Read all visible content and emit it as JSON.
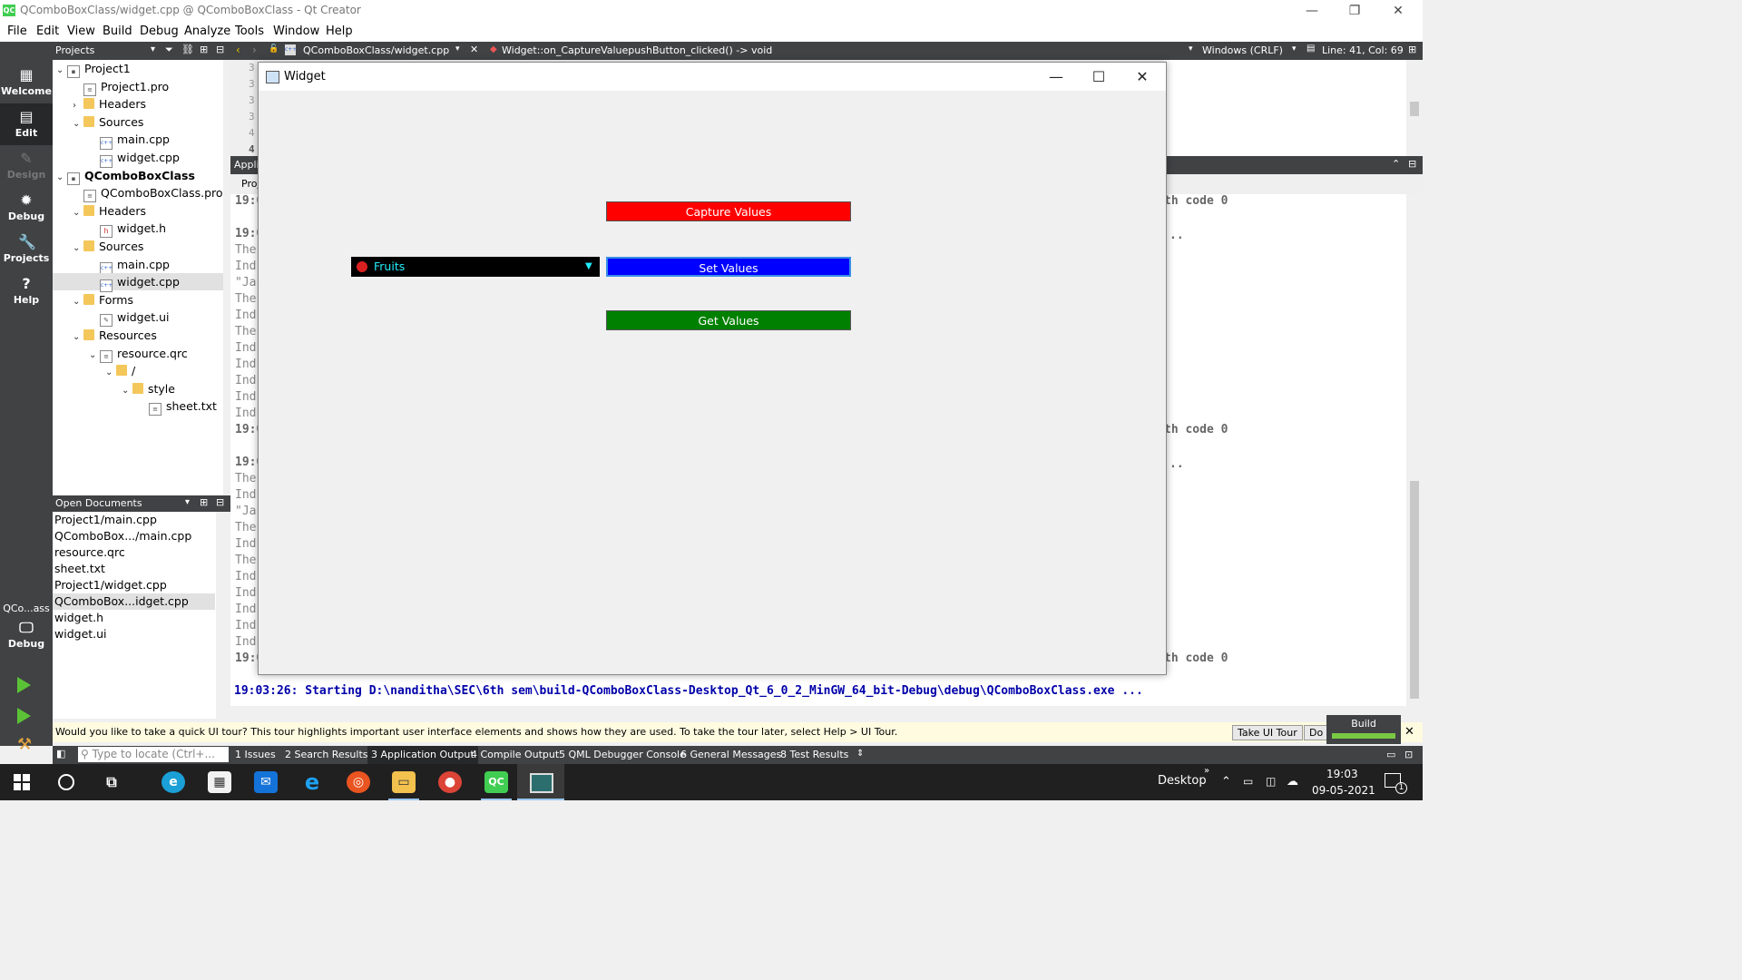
{
  "window": {
    "title": "QComboBoxClass/widget.cpp @ QComboBoxClass - Qt Creator",
    "app_logo": "QC"
  },
  "menu": [
    "File",
    "Edit",
    "View",
    "Build",
    "Debug",
    "Analyze",
    "Tools",
    "Window",
    "Help"
  ],
  "modes": [
    {
      "label": "Welcome",
      "icon": "grid-icon"
    },
    {
      "label": "Edit",
      "icon": "edit-icon"
    },
    {
      "label": "Design",
      "icon": "pencil-icon"
    },
    {
      "label": "Debug",
      "icon": "bug-icon"
    },
    {
      "label": "Projects",
      "icon": "wrench-icon"
    },
    {
      "label": "Help",
      "icon": "help-icon"
    }
  ],
  "kit": {
    "label": "QCo...ass",
    "mode": "Debug"
  },
  "projects_panel": {
    "title": "Projects",
    "tree": [
      {
        "label": "Project1",
        "depth": 0,
        "arrow": "down",
        "icon": "project",
        "bold": false
      },
      {
        "label": "Project1.pro",
        "depth": 1,
        "arrow": "",
        "icon": "pro"
      },
      {
        "label": "Headers",
        "depth": 1,
        "arrow": "right",
        "icon": "folder"
      },
      {
        "label": "Sources",
        "depth": 1,
        "arrow": "down",
        "icon": "folder"
      },
      {
        "label": "main.cpp",
        "depth": 2,
        "arrow": "",
        "icon": "cpp"
      },
      {
        "label": "widget.cpp",
        "depth": 2,
        "arrow": "",
        "icon": "cpp"
      },
      {
        "label": "QComboBoxClass",
        "depth": 0,
        "arrow": "down",
        "icon": "project",
        "bold": true
      },
      {
        "label": "QComboBoxClass.pro",
        "depth": 1,
        "arrow": "",
        "icon": "pro"
      },
      {
        "label": "Headers",
        "depth": 1,
        "arrow": "down",
        "icon": "folder"
      },
      {
        "label": "widget.h",
        "depth": 2,
        "arrow": "",
        "icon": "h"
      },
      {
        "label": "Sources",
        "depth": 1,
        "arrow": "down",
        "icon": "folder"
      },
      {
        "label": "main.cpp",
        "depth": 2,
        "arrow": "",
        "icon": "cpp"
      },
      {
        "label": "widget.cpp",
        "depth": 2,
        "arrow": "",
        "icon": "cpp",
        "selected": true
      },
      {
        "label": "Forms",
        "depth": 1,
        "arrow": "down",
        "icon": "folder"
      },
      {
        "label": "widget.ui",
        "depth": 2,
        "arrow": "",
        "icon": "ui"
      },
      {
        "label": "Resources",
        "depth": 1,
        "arrow": "down",
        "icon": "folder"
      },
      {
        "label": "resource.qrc",
        "depth": 2,
        "arrow": "down",
        "icon": "pro"
      },
      {
        "label": "/",
        "depth": 3,
        "arrow": "down",
        "icon": "folder"
      },
      {
        "label": "style",
        "depth": 4,
        "arrow": "down",
        "icon": "folder"
      },
      {
        "label": "sheet.txt",
        "depth": 5,
        "arrow": "",
        "icon": "txt"
      }
    ]
  },
  "open_documents": {
    "title": "Open Documents",
    "items": [
      {
        "label": "Project1/main.cpp"
      },
      {
        "label": "QComboBox.../main.cpp"
      },
      {
        "label": "resource.qrc"
      },
      {
        "label": "sheet.txt"
      },
      {
        "label": "Project1/widget.cpp"
      },
      {
        "label": "QComboBox...idget.cpp",
        "selected": true
      },
      {
        "label": "widget.h"
      },
      {
        "label": "widget.ui"
      }
    ]
  },
  "editor_bar": {
    "file": "QComboBoxClass/widget.cpp",
    "symbol": "Widget::on_CaptureValuepushButton_clicked() -> void",
    "line_ending": "Windows (CRLF)",
    "position": "Line: 41, Col: 69"
  },
  "gutter_lines": [
    "3",
    "3",
    "3",
    "3",
    "4",
    "4"
  ],
  "output_pane": {
    "tab_label": "Appli",
    "subtab": "Proj",
    "lines": [
      {
        "text": "19:0",
        "style": "c"
      },
      {
        "text": "",
        "style": ""
      },
      {
        "text": "19:0",
        "style": "c"
      },
      {
        "text": "The",
        "style": ""
      },
      {
        "text": "Ind",
        "style": ""
      },
      {
        "text": "\"Ja",
        "style": ""
      },
      {
        "text": "The",
        "style": ""
      },
      {
        "text": "Ind",
        "style": ""
      },
      {
        "text": "The",
        "style": ""
      },
      {
        "text": "Ind",
        "style": ""
      },
      {
        "text": "Ind",
        "style": ""
      },
      {
        "text": "Ind",
        "style": ""
      },
      {
        "text": "Ind",
        "style": ""
      },
      {
        "text": "Ind",
        "style": ""
      },
      {
        "text": "19:0",
        "style": "c"
      },
      {
        "text": "",
        "style": ""
      },
      {
        "text": "19:0",
        "style": "c"
      },
      {
        "text": "The",
        "style": ""
      },
      {
        "text": "Ind",
        "style": ""
      },
      {
        "text": "\"Ja",
        "style": ""
      },
      {
        "text": "The",
        "style": ""
      },
      {
        "text": "Ind",
        "style": ""
      },
      {
        "text": "The",
        "style": ""
      },
      {
        "text": "Ind",
        "style": ""
      },
      {
        "text": "Ind",
        "style": ""
      },
      {
        "text": "Ind",
        "style": ""
      },
      {
        "text": "Ind",
        "style": ""
      },
      {
        "text": "Ind",
        "style": ""
      },
      {
        "text": "19:0",
        "style": "c"
      }
    ],
    "right_fragments": [
      "th code 0",
      "..",
      "th code 0",
      "..",
      "th code 0"
    ],
    "starting_line": "19:03:26: Starting D:\\nanditha\\SEC\\6th sem\\build-QComboBoxClass-Desktop_Qt_6_0_2_MinGW_64_bit-Debug\\debug\\QComboBoxClass.exe ..."
  },
  "widget_window": {
    "title": "Widget",
    "combo": {
      "value": "Fruits",
      "icon": "apple-icon"
    },
    "buttons": [
      {
        "label": "Capture Values",
        "color": "#ff0000"
      },
      {
        "label": "Set Values",
        "color": "#0000ff"
      },
      {
        "label": "Get Values",
        "color": "#008000"
      }
    ]
  },
  "tour_bar": {
    "message": "Would you like to take a quick UI tour? This tour highlights important user interface elements and shows how they are used. To take the tour later, select Help > UI Tour.",
    "take_tour": "Take UI Tour",
    "do_not": "Do N"
  },
  "build_indicator": {
    "label": "Build",
    "progress": 1.0,
    "color": "#7ac943"
  },
  "status_bar": {
    "locator_placeholder": "Type to locate (Ctrl+...",
    "tabs": [
      "1  Issues",
      "2  Search Results",
      "3  Application Output",
      "4  Compile Output",
      "5  QML Debugger Console",
      "6  General Messages",
      "8  Test Results"
    ]
  },
  "taskbar": {
    "desktop_label": "Desktop",
    "time": "19:03",
    "date": "09-05-2021",
    "notification_count": "1",
    "apps": [
      "windows-icon",
      "search-circle-icon",
      "task-view-icon",
      "edge-icon",
      "store-icon",
      "mail-icon",
      "ie-icon",
      "ubuntu-icon",
      "explorer-icon",
      "chrome-icon",
      "qtcreator-icon",
      "widget-app-icon"
    ]
  }
}
